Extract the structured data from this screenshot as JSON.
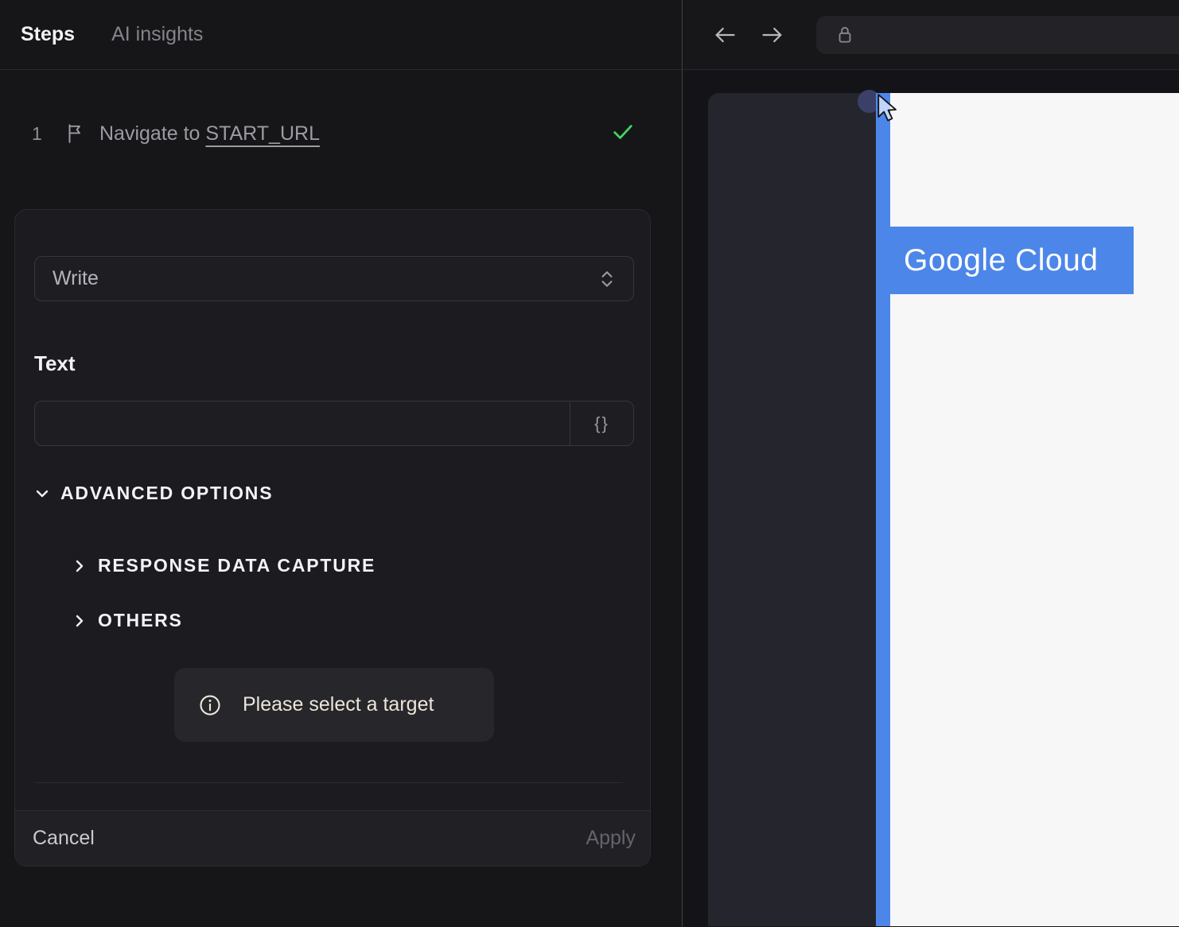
{
  "left_panel": {
    "tabs": [
      {
        "label": "Steps"
      },
      {
        "label": "AI insights"
      }
    ],
    "step": {
      "number": "1",
      "action_text": "Navigate to ",
      "target_text": "START_URL",
      "status": "success"
    },
    "editor": {
      "action_select": {
        "value": "Write"
      },
      "text_field": {
        "label": "Text",
        "value": "",
        "variable_button_label": "{}"
      },
      "advanced_options": {
        "label": "ADVANCED OPTIONS",
        "expanded": true
      },
      "sections": [
        {
          "label": "RESPONSE DATA CAPTURE",
          "expanded": false
        },
        {
          "label": "OTHERS",
          "expanded": false
        }
      ],
      "notice": {
        "text": "Please select a target"
      },
      "footer": {
        "cancel_label": "Cancel",
        "apply_label": "Apply"
      }
    }
  },
  "browser": {
    "toolbar": {
      "url_value": ""
    },
    "page": {
      "highlight_label": "Google Cloud"
    }
  },
  "colors": {
    "accent_blue": "#4c86e9",
    "success_green": "#3fd95c",
    "notice_text": "#ece5d9"
  }
}
